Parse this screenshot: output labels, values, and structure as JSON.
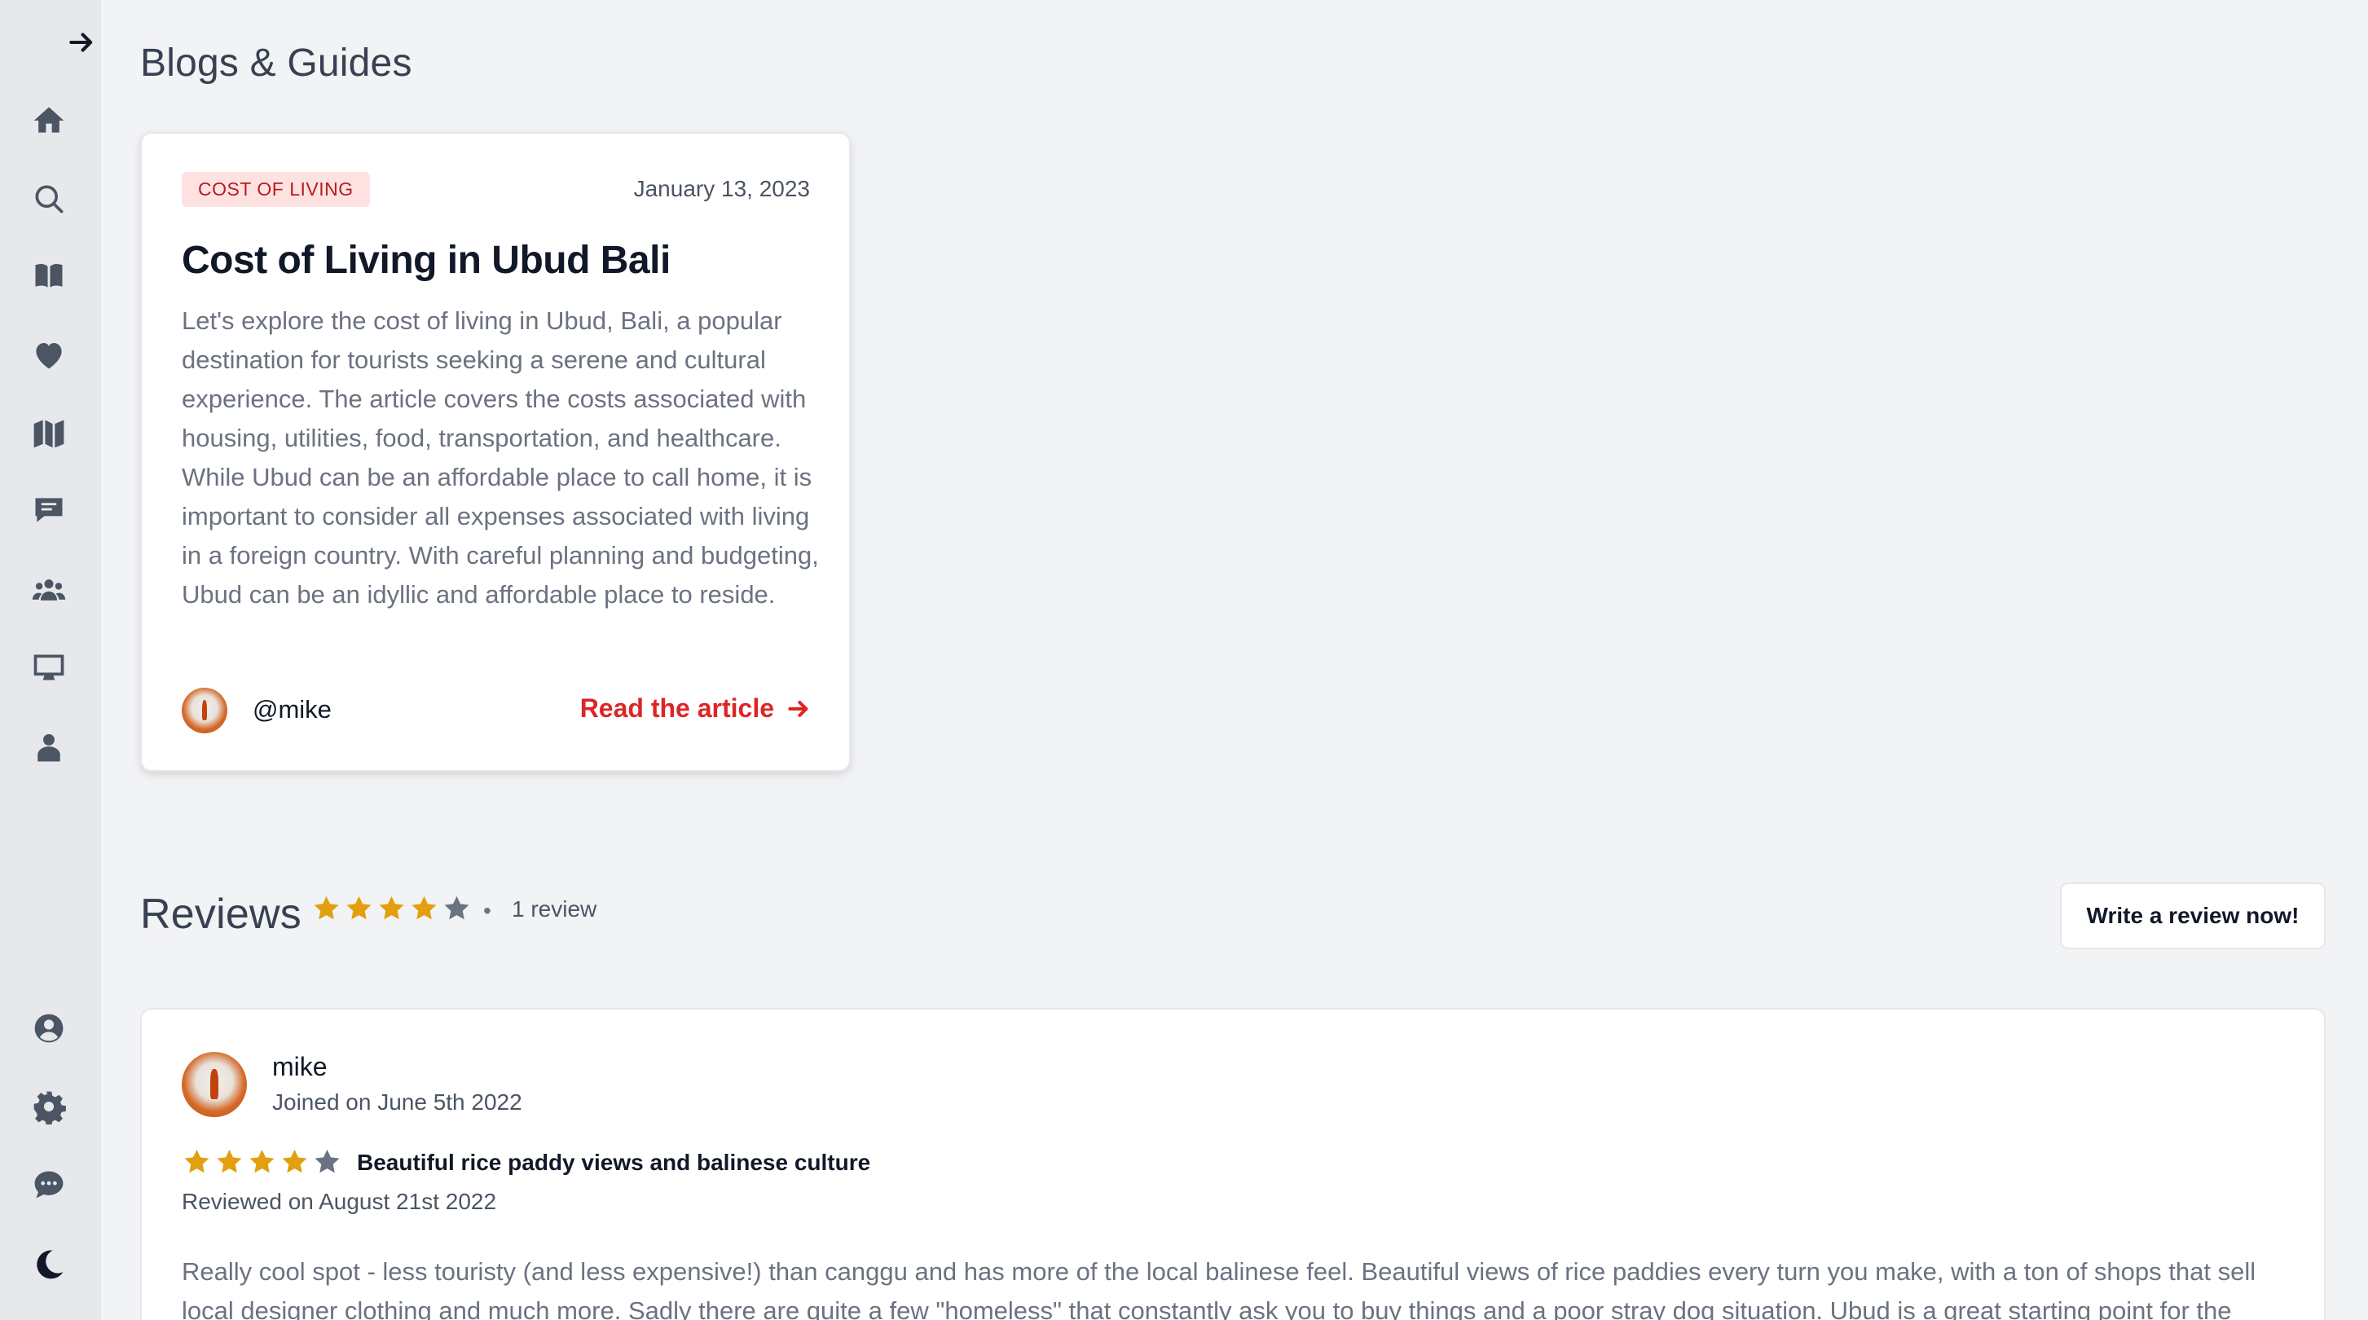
{
  "sidebar": {
    "expand_icon": "arrow-right-icon",
    "top_icons": [
      "home-icon",
      "search-icon",
      "book-icon",
      "heart-icon",
      "map-icon",
      "chat-icon",
      "users-icon",
      "desktop-icon",
      "person-icon"
    ],
    "bottom_icons": [
      "user-circle-icon",
      "gear-icon",
      "chat-bubble-icon",
      "moon-icon"
    ]
  },
  "blogs": {
    "title": "Blogs & Guides",
    "card": {
      "category": "COST OF LIVING",
      "date": "January 13, 2023",
      "title": "Cost of Living in Ubud Bali",
      "excerpt": "Let's explore the cost of living in Ubud, Bali, a popular destination for tourists seeking a serene and cultural experience. The article covers the costs associated with housing, utilities, food, transportation, and healthcare. While Ubud can be an affordable place to call home, it is important to consider all expenses associated with living in a foreign country. With careful planning and budgeting, Ubud can be an idyllic and affordable place to reside.",
      "author": "@mike",
      "read_label": "Read the article"
    }
  },
  "reviews": {
    "title": "Reviews",
    "rating": 4,
    "rating_max": 5,
    "dot": "•",
    "count_label": "1 review",
    "write_label": "Write a review now!",
    "items": [
      {
        "name": "mike",
        "joined": "Joined on June 5th 2022",
        "rating": 4,
        "rating_max": 5,
        "title": "Beautiful rice paddy views and balinese culture",
        "reviewed_on": "Reviewed on August 21st 2022",
        "text": "Really cool spot - less touristy (and less expensive!) than canggu and has more of the local balinese feel. Beautiful views of rice paddies every turn you make, with a ton of shops that sell local designer clothing and much more. Sadly there are quite a few \"homeless\" that constantly ask you to buy things and a poor stray dog situation. Ubud is a great starting point for the"
      }
    ]
  },
  "colors": {
    "accent": "#dc2626",
    "star_filled": "#e2a00e",
    "star_empty": "#6b7280",
    "badge_bg": "#fee2e2"
  }
}
